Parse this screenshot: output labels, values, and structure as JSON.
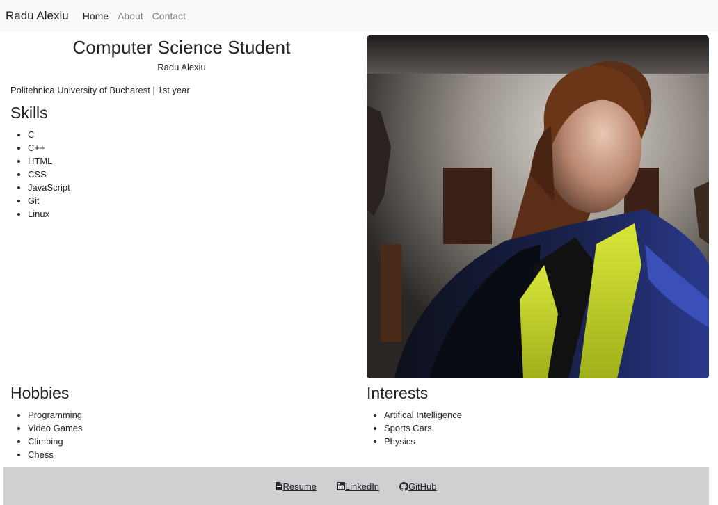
{
  "nav": {
    "brand": "Radu Alexiu",
    "links": [
      {
        "label": "Home"
      },
      {
        "label": "About"
      },
      {
        "label": "Contact"
      }
    ]
  },
  "hero": {
    "title": "Computer Science Student",
    "name": "Radu Alexiu",
    "university": "Politehnica University of Bucharest | 1st year"
  },
  "skills": {
    "heading": "Skills",
    "items": [
      "C",
      "C++",
      "HTML",
      "CSS",
      "JavaScript",
      "Git",
      "Linux"
    ]
  },
  "hobbies": {
    "heading": "Hobbies",
    "items": [
      "Programming",
      "Video Games",
      "Climbing",
      "Chess"
    ]
  },
  "interests": {
    "heading": "Interests",
    "items": [
      "Artifical Intelligence",
      "Sports Cars",
      "Physics"
    ]
  },
  "footer": {
    "links": [
      {
        "label": "Resume",
        "icon": "file-icon"
      },
      {
        "label": "LinkedIn",
        "icon": "linkedin-icon"
      },
      {
        "label": "GitHub",
        "icon": "github-icon"
      }
    ]
  },
  "colors": {
    "navbar_bg": "#f8f9fa",
    "footer_bg": "#cfd0d2",
    "text": "#212529",
    "nav_inactive": "#7a7a7a"
  }
}
